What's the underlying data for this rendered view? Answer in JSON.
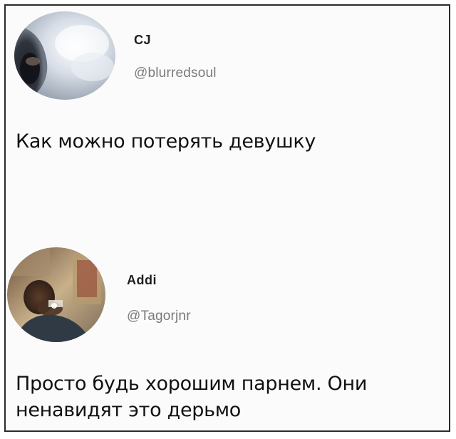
{
  "tweets": [
    {
      "display_name": "CJ",
      "handle": "@blurredsoul",
      "text": "Как можно потерять девушку",
      "avatar_icon": "user-avatar-photo"
    },
    {
      "display_name": "Addi",
      "handle": "@Tagorjnr",
      "text": "Просто будь хорошим парнем. Они ненавидят это дерьмо",
      "avatar_icon": "user-avatar-photo"
    }
  ],
  "colors": {
    "text": "#111111",
    "handle": "#7a7a7a",
    "frame_border": "#2b2b2b",
    "background": "#fbfbfb"
  }
}
